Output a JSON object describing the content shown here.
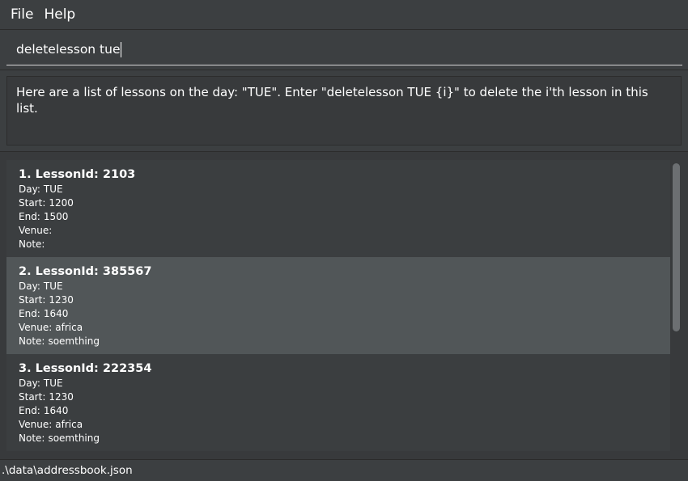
{
  "menu": {
    "file": "File",
    "help": "Help"
  },
  "command": {
    "value": "deletelesson tue"
  },
  "result": {
    "message": "Here are a list of lessons on the day: \"TUE\". Enter \"deletelesson TUE {i}\" to delete the i'th lesson in this list."
  },
  "field_labels": {
    "day": "Day:",
    "start": "Start:",
    "end": "End:",
    "venue": "Venue:",
    "note": "Note:"
  },
  "lessons": [
    {
      "title": "1. LessonId: 2103",
      "day": "TUE",
      "start": "1200",
      "end": "1500",
      "venue": "",
      "note": "",
      "selected": false
    },
    {
      "title": "2. LessonId: 385567",
      "day": "TUE",
      "start": "1230",
      "end": "1640",
      "venue": "africa",
      "note": "soemthing",
      "selected": true
    },
    {
      "title": "3. LessonId: 222354",
      "day": "TUE",
      "start": "1230",
      "end": "1640",
      "venue": "africa",
      "note": "soemthing",
      "selected": false
    }
  ],
  "statusbar": {
    "path": ".\\data\\addressbook.json"
  },
  "colors": {
    "background": "#3c3f41",
    "selected_card": "#515658",
    "card": "#3b3e40"
  }
}
